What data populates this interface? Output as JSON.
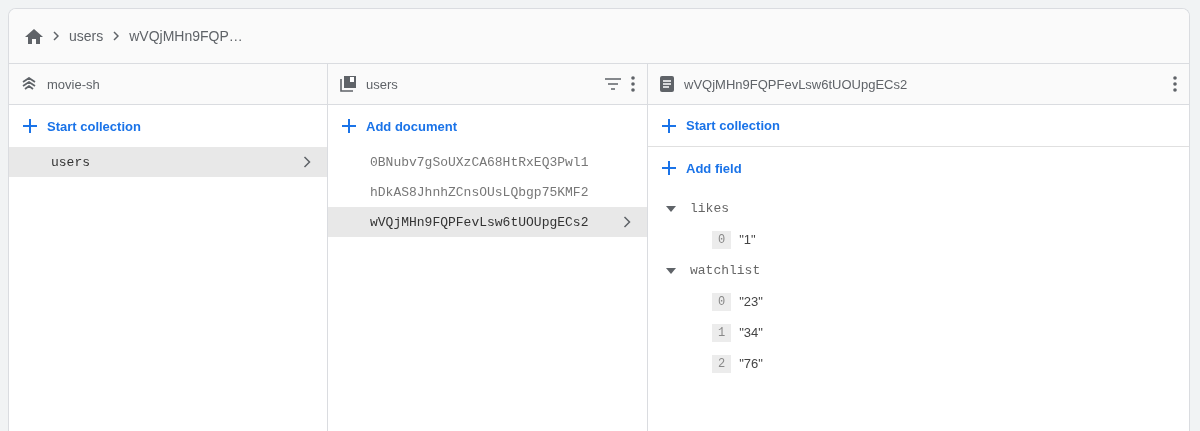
{
  "breadcrumb": [
    "users",
    "wVQjMHn9FQP…"
  ],
  "columns": [
    {
      "kind": "root",
      "title": "movie-sh",
      "action": "Start collection",
      "items": [
        {
          "label": "users",
          "selected": true
        }
      ]
    },
    {
      "kind": "collection",
      "title": "users",
      "action": "Add document",
      "items": [
        {
          "label": "0BNubv7gSoUXzCA68HtRxEQ3Pwl1",
          "selected": false
        },
        {
          "label": "hDkAS8JhnhZCnsOUsLQbgp75KMF2",
          "selected": false
        },
        {
          "label": "wVQjMHn9FQPFevLsw6tUOUpgECs2",
          "selected": true
        }
      ]
    },
    {
      "kind": "document",
      "title": "wVQjMHn9FQPFevLsw6tUOUpgECs2",
      "action": "Start collection",
      "field_action": "Add field",
      "fields": [
        {
          "name": "likes",
          "expanded": true,
          "children": [
            {
              "index": "0",
              "value": "\"1\""
            }
          ]
        },
        {
          "name": "watchlist",
          "expanded": true,
          "children": [
            {
              "index": "0",
              "value": "\"23\""
            },
            {
              "index": "1",
              "value": "\"34\""
            },
            {
              "index": "2",
              "value": "\"76\""
            }
          ]
        }
      ]
    }
  ]
}
